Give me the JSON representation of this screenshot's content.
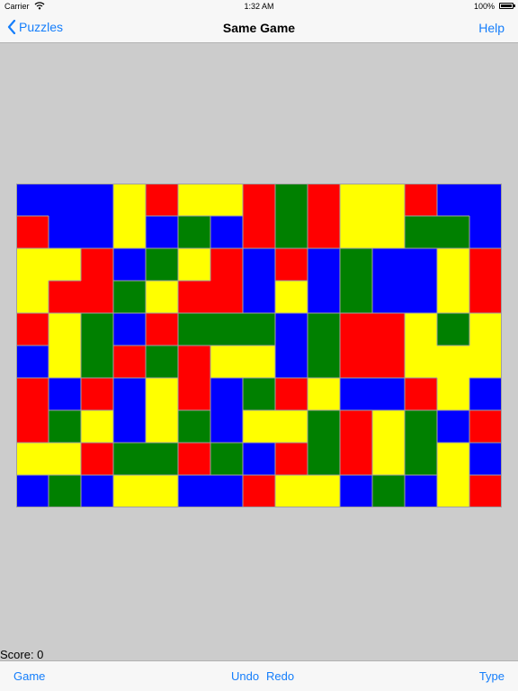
{
  "status_bar": {
    "carrier": "Carrier",
    "time": "1:32 AM",
    "battery": "100%",
    "wifi_icon": "wifi-icon",
    "battery_icon": "battery-icon"
  },
  "nav": {
    "back_label": "Puzzles",
    "back_icon": "chevron-left-icon",
    "title": "Same Game",
    "help_label": "Help"
  },
  "board": {
    "columns": 15,
    "rows": 10,
    "colors": {
      "B": "#0000ff",
      "R": "#ff0000",
      "Y": "#ffff00",
      "G": "#008000"
    },
    "grid_line_color": "#a0a0a0",
    "cells": [
      "BBBYRYYRGRYYRBB",
      "RBBYBGBRGRYYGGB",
      "YYRBGYRBRBGBBYR",
      "YRRGYRRBYBGBBYR",
      "RYGBRGGGBGRRYGY",
      "BYGRGRYYBGRRYYY",
      "RBRBYRBGRYBBRYB",
      "RGYBYGBYYGRYGBR",
      "YYRGGRGBRGRYGYB",
      "BGBYYBBRYYBGBYR"
    ]
  },
  "score_label": "Score: 0",
  "toolbar": {
    "game": "Game",
    "undo": "Undo",
    "redo": "Redo",
    "type": "Type"
  }
}
